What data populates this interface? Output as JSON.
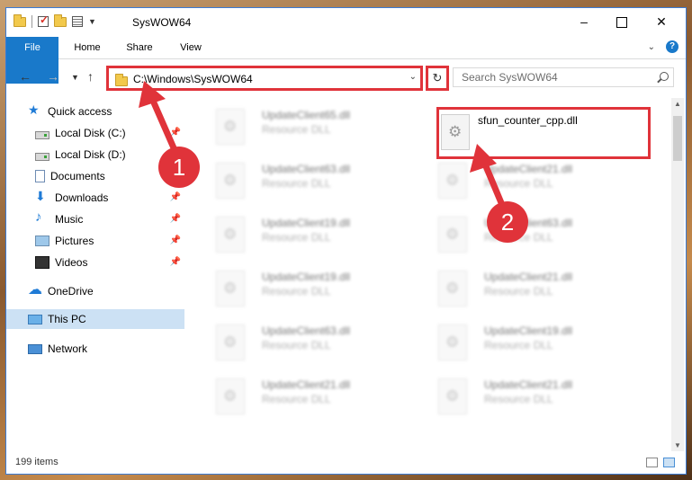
{
  "window": {
    "title": "SysWOW64",
    "controls": {
      "minimize": "–",
      "close": "✕"
    }
  },
  "ribbon": {
    "tabs": [
      "File",
      "Home",
      "Share",
      "View"
    ]
  },
  "address": {
    "path": "C:\\Windows\\SysWOW64",
    "search_placeholder": "Search SysWOW64"
  },
  "sidebar": {
    "items": [
      {
        "label": "Quick access",
        "icon": "star-icon",
        "pinned": false
      },
      {
        "label": "Local Disk (C:)",
        "icon": "disk-icon",
        "pinned": true
      },
      {
        "label": "Local Disk (D:)",
        "icon": "disk-icon",
        "pinned": false
      },
      {
        "label": "Documents",
        "icon": "documents-icon",
        "pinned": true
      },
      {
        "label": "Downloads",
        "icon": "downloads-icon",
        "pinned": true
      },
      {
        "label": "Music",
        "icon": "music-icon",
        "pinned": true
      },
      {
        "label": "Pictures",
        "icon": "pictures-icon",
        "pinned": true
      },
      {
        "label": "Videos",
        "icon": "videos-icon",
        "pinned": true
      },
      {
        "label": "OneDrive",
        "icon": "onedrive-icon",
        "pinned": false
      },
      {
        "label": "This PC",
        "icon": "this-pc-icon",
        "pinned": false,
        "selected": true
      },
      {
        "label": "Network",
        "icon": "network-icon",
        "pinned": false
      }
    ]
  },
  "files": {
    "highlighted": {
      "name": "sfun_counter_cpp.dll"
    },
    "left_column": [
      {
        "name": "UpdateClient65.dll",
        "type": "Resource DLL"
      },
      {
        "name": "UpdateClient63.dll",
        "type": "Resource DLL"
      },
      {
        "name": "UpdateClient19.dll",
        "type": "Resource DLL"
      },
      {
        "name": "UpdateClient19.dll",
        "type": "Resource DLL"
      },
      {
        "name": "UpdateClient63.dll",
        "type": "Resource DLL"
      },
      {
        "name": "UpdateClient21.dll",
        "type": "Resource DLL"
      }
    ],
    "right_column": [
      {
        "name": "UpdateClient21.dll",
        "type": "Resource DLL"
      },
      {
        "name": "UpdateClient63.dll",
        "type": "Resource DLL"
      },
      {
        "name": "UpdateClient21.dll",
        "type": "Resource DLL"
      },
      {
        "name": "UpdateClient19.dll",
        "type": "Resource DLL"
      },
      {
        "name": "UpdateClient21.dll",
        "type": "Resource DLL"
      }
    ]
  },
  "status": {
    "item_count": "199 items"
  },
  "callouts": {
    "first": "1",
    "second": "2"
  },
  "colors": {
    "accent": "#1979ca",
    "highlight": "#e0333a",
    "selected": "#cce1f4"
  }
}
